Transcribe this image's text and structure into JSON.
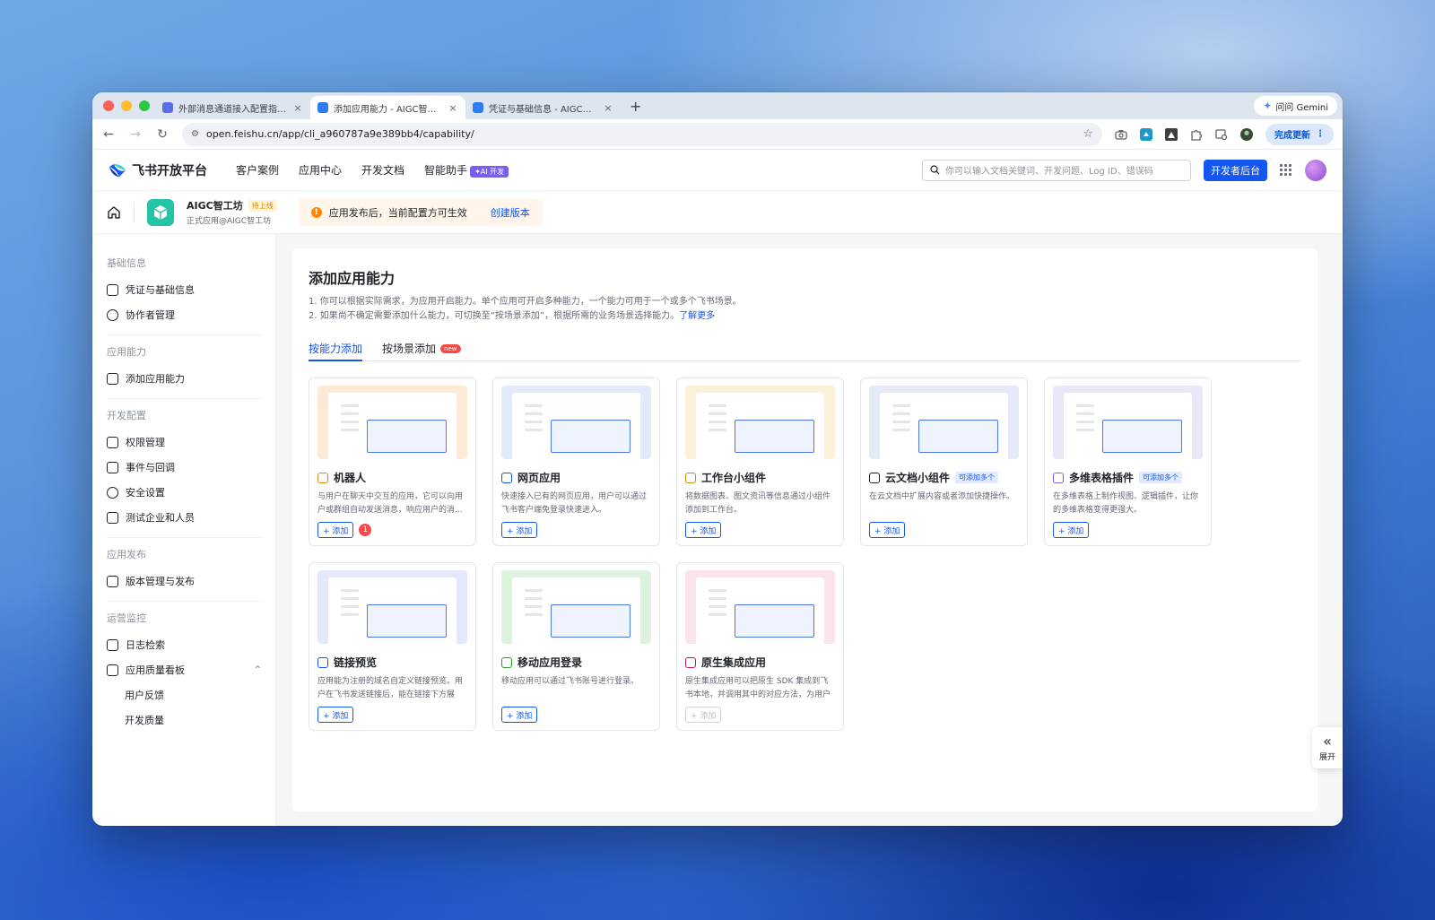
{
  "browser": {
    "tabs": [
      {
        "title": "外部消息通道接入配置指南 - 知",
        "favicon_color": "#5b6ee8",
        "active": false
      },
      {
        "title": "添加应用能力 - AIGC智工坊 - 开",
        "favicon_color": "#2e7cf6",
        "active": true
      },
      {
        "title": "凭证与基础信息 - AIGC智工坊",
        "favicon_color": "#2e7cf6",
        "active": false
      }
    ],
    "new_tab": "+",
    "close_glyph": "×",
    "gemini_label": "问问 Gemini",
    "url": "open.feishu.cn/app/cli_a960787a9e389bb4/capability/",
    "update_label": "完成更新"
  },
  "header": {
    "logo_text": "飞书开放平台",
    "nav": [
      "客户案例",
      "应用中心",
      "开发文档",
      "智能助手"
    ],
    "ai_badge": "✦AI 开发",
    "search_placeholder": "你可以输入文档关键词、开发问题、Log ID、错误码",
    "dev_console": "开发者后台"
  },
  "appbar": {
    "app_name": "AIGC智工坊",
    "app_status": "待上线",
    "app_sub": "正式应用@AIGC智工坊",
    "notice_icon": "!",
    "notice_text": "应用发布后，当前配置方可生效",
    "notice_link": "创建版本"
  },
  "sidebar": {
    "groups": [
      {
        "title": "基础信息",
        "items": [
          {
            "label": "凭证与基础信息",
            "icon": "id-card-icon"
          },
          {
            "label": "协作者管理",
            "icon": "user-icon"
          }
        ]
      },
      {
        "title": "应用能力",
        "items": [
          {
            "label": "添加应用能力",
            "icon": "apps-icon"
          }
        ]
      },
      {
        "title": "开发配置",
        "items": [
          {
            "label": "权限管理",
            "icon": "lock-icon"
          },
          {
            "label": "事件与回调",
            "icon": "event-icon"
          },
          {
            "label": "安全设置",
            "icon": "shield-icon"
          },
          {
            "label": "测试企业和人员",
            "icon": "test-icon"
          }
        ]
      },
      {
        "title": "应用发布",
        "items": [
          {
            "label": "版本管理与发布",
            "icon": "upload-icon"
          }
        ]
      },
      {
        "title": "运营监控",
        "items": [
          {
            "label": "日志检索",
            "icon": "log-icon"
          },
          {
            "label": "应用质量看板",
            "icon": "chart-icon"
          }
        ]
      }
    ],
    "sub_items": [
      "用户反馈",
      "开发质量"
    ],
    "chevron": "^"
  },
  "main": {
    "title": "添加应用能力",
    "desc1": "1. 你可以根据实际需求，为应用开启能力。单个应用可开启多种能力，一个能力可用于一个或多个飞书场景。",
    "desc2": "2. 如果尚不确定需要添加什么能力，可切换至“按场景添加”，根据所需的业务场景选择能力。",
    "desc2_link": "了解更多",
    "tabs": [
      "按能力添加",
      "按场景添加"
    ],
    "new_badge": "new",
    "add_label": "+ 添加",
    "multi_badge": "可添加多个",
    "cards": [
      {
        "title": "机器人",
        "desc": "与用户在聊天中交互的应用，它可以向用户或群组自动发送消息，响应用户的消...",
        "color": "#fde9d4",
        "icon_color": "#e08a1e",
        "badge": false,
        "count": "1",
        "disabled": false
      },
      {
        "title": "网页应用",
        "desc": "快速接入已有的网页应用，用户可以通过飞书客户端免登录快速进入。",
        "color": "#e3ebfb",
        "icon_color": "#1456f0",
        "badge": false,
        "count": "",
        "disabled": false
      },
      {
        "title": "工作台小组件",
        "desc": "将数据图表、图文资讯等信息通过小组件添加到工作台。",
        "color": "#fbf0d8",
        "icon_color": "#d48806",
        "badge": false,
        "count": "",
        "disabled": false
      },
      {
        "title": "云文档小组件",
        "desc": "在云文档中扩展内容或者添加快捷操作。",
        "color": "#e6eaf8",
        "icon_color": "#1f2329",
        "badge": true,
        "count": "",
        "disabled": false
      },
      {
        "title": "多维表格插件",
        "desc": "在多维表格上制作视图、逻辑插件，让你的多维表格变得更强大。",
        "color": "#ebe6f8",
        "icon_color": "#7b5cf5",
        "badge": true,
        "count": "",
        "disabled": false
      },
      {
        "title": "链接预览",
        "desc": "应用能为注册的域名自定义链接预览。用户在飞书发送链接后，能在链接下方展示...",
        "color": "#e3e9fb",
        "icon_color": "#1456f0",
        "badge": false,
        "count": "",
        "disabled": false
      },
      {
        "title": "移动应用登录",
        "desc": "移动应用可以通过飞书账号进行登录。",
        "color": "#ddf3df",
        "icon_color": "#2ea121",
        "badge": false,
        "count": "",
        "disabled": false
      },
      {
        "title": "原生集成应用",
        "desc": "原生集成应用可以把原生 SDK 集成到飞书本地，并调用其中的对应方法，为用户提...",
        "color": "#fbe3ea",
        "icon_color": "#c2185b",
        "badge": false,
        "count": "",
        "disabled": true
      }
    ]
  },
  "expand": {
    "arrow": "«",
    "label": "展开"
  }
}
